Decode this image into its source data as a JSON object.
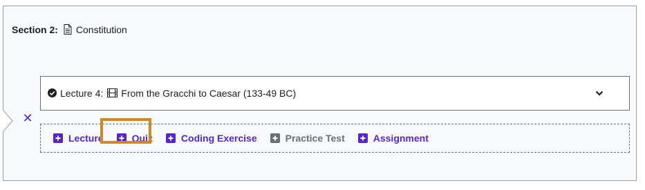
{
  "section": {
    "label": "Section 2:",
    "title": "Constitution",
    "icon": "document-icon"
  },
  "lecture": {
    "label": "Lecture 4:",
    "title": "From the Gracchi to Caesar (133-49 BC)",
    "status_icon": "check-circle-icon",
    "type_icon": "film-icon",
    "expand_icon": "chevron-down-icon"
  },
  "close": {
    "glyph": "✕",
    "icon": "close-icon"
  },
  "add_items": [
    {
      "label": "Lecture",
      "enabled": true
    },
    {
      "label": "Quiz",
      "enabled": true,
      "highlighted": true
    },
    {
      "label": "Coding Exercise",
      "enabled": true
    },
    {
      "label": "Practice Test",
      "enabled": false
    },
    {
      "label": "Assignment",
      "enabled": true
    }
  ],
  "colors": {
    "accent": "#5624d0",
    "disabled": "#6a6f73",
    "highlight": "#cc8a20",
    "section_bg": "#f7f9fa"
  }
}
